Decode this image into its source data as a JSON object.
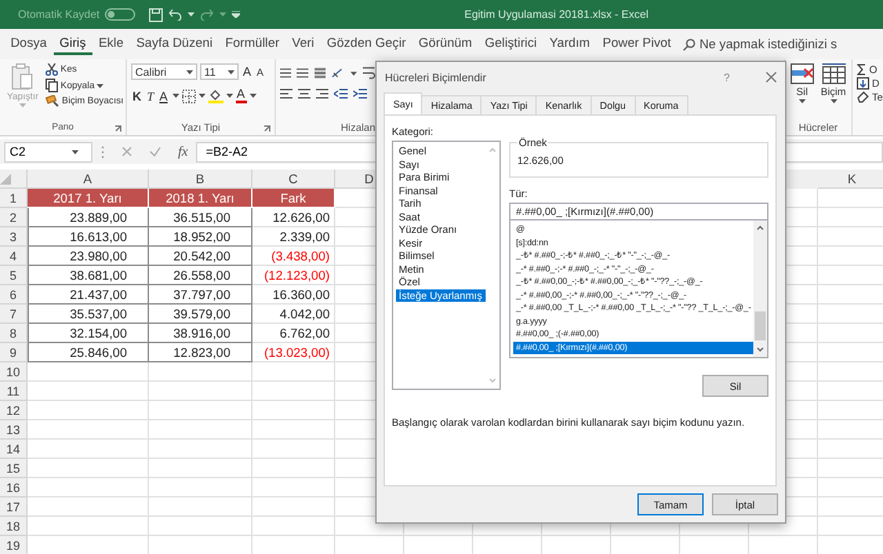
{
  "title_bar": {
    "autosave_label": "Otomatik Kaydet",
    "autosave_on": false,
    "title": "Egitim Uygulamasi 20181.xlsx  -  Excel"
  },
  "menu_tabs": [
    {
      "label": "Dosya",
      "selected": false
    },
    {
      "label": "Giriş",
      "selected": true
    },
    {
      "label": "Ekle",
      "selected": false
    },
    {
      "label": "Sayfa Düzeni",
      "selected": false
    },
    {
      "label": "Formüller",
      "selected": false
    },
    {
      "label": "Veri",
      "selected": false
    },
    {
      "label": "Gözden Geçir",
      "selected": false
    },
    {
      "label": "Görünüm",
      "selected": false
    },
    {
      "label": "Geliştirici",
      "selected": false
    },
    {
      "label": "Yardım",
      "selected": false
    },
    {
      "label": "Power Pivot",
      "selected": false
    }
  ],
  "search": {
    "placeholder": "Ne yapmak istediğinizi s"
  },
  "ribbon": {
    "clipboard": {
      "label": "Pano",
      "paste": "Yapıştır",
      "paste_disabled": true,
      "cut": "Kes",
      "copy": "Kopyala",
      "format_painter": "Biçim Boyacısı"
    },
    "font": {
      "label": "Yazı Tipi",
      "font_name": "Calibri",
      "font_size": "11",
      "grow": "A",
      "shrink": "A",
      "bold": "K",
      "italic": "T",
      "underline": "A",
      "font_color": "A"
    },
    "alignment": {
      "label": "Hizalan"
    },
    "cells": {
      "label": "Hücreler",
      "delete": "Sil",
      "format": "Biçim"
    },
    "editing": {
      "autosum": "O",
      "fill": "D",
      "clear": "Te"
    }
  },
  "formula_bar": {
    "name_box": "C2",
    "fx": "fx",
    "formula": "=B2-A2"
  },
  "sheet": {
    "columns": [
      {
        "label": "A"
      },
      {
        "label": "B"
      },
      {
        "label": "C"
      },
      {
        "label": "D"
      },
      {
        "label": "K"
      }
    ],
    "rows": [
      {
        "number": "1",
        "kind": "header",
        "cells": [
          {
            "text": "2017 1. Yarı",
            "negative": false
          },
          {
            "text": "2018 1. Yarı",
            "negative": false
          },
          {
            "text": "Fark",
            "negative": false
          }
        ]
      },
      {
        "number": "2",
        "kind": "data",
        "cells": [
          {
            "text": "23.889,00",
            "negative": false
          },
          {
            "text": "36.515,00",
            "negative": false
          },
          {
            "text": "12.626,00",
            "negative": false
          }
        ]
      },
      {
        "number": "3",
        "kind": "data",
        "cells": [
          {
            "text": "16.613,00",
            "negative": false
          },
          {
            "text": "18.952,00",
            "negative": false
          },
          {
            "text": "2.339,00",
            "negative": false
          }
        ]
      },
      {
        "number": "4",
        "kind": "data",
        "cells": [
          {
            "text": "23.980,00",
            "negative": false
          },
          {
            "text": "20.542,00",
            "negative": false
          },
          {
            "text": "(3.438,00)",
            "negative": true
          }
        ]
      },
      {
        "number": "5",
        "kind": "data",
        "cells": [
          {
            "text": "38.681,00",
            "negative": false
          },
          {
            "text": "26.558,00",
            "negative": false
          },
          {
            "text": "(12.123,00)",
            "negative": true
          }
        ]
      },
      {
        "number": "6",
        "kind": "data",
        "cells": [
          {
            "text": "21.437,00",
            "negative": false
          },
          {
            "text": "37.797,00",
            "negative": false
          },
          {
            "text": "16.360,00",
            "negative": false
          }
        ]
      },
      {
        "number": "7",
        "kind": "data",
        "cells": [
          {
            "text": "35.537,00",
            "negative": false
          },
          {
            "text": "39.579,00",
            "negative": false
          },
          {
            "text": "4.042,00",
            "negative": false
          }
        ]
      },
      {
        "number": "8",
        "kind": "data",
        "cells": [
          {
            "text": "32.154,00",
            "negative": false
          },
          {
            "text": "38.916,00",
            "negative": false
          },
          {
            "text": "6.762,00",
            "negative": false
          }
        ]
      },
      {
        "number": "9",
        "kind": "data",
        "cells": [
          {
            "text": "25.846,00",
            "negative": false
          },
          {
            "text": "12.823,00",
            "negative": false
          },
          {
            "text": "(13.023,00)",
            "negative": true
          }
        ]
      },
      {
        "number": "10",
        "kind": "empty"
      },
      {
        "number": "11",
        "kind": "empty"
      },
      {
        "number": "12",
        "kind": "empty"
      },
      {
        "number": "13",
        "kind": "empty"
      },
      {
        "number": "14",
        "kind": "empty"
      },
      {
        "number": "15",
        "kind": "empty"
      },
      {
        "number": "16",
        "kind": "empty"
      },
      {
        "number": "17",
        "kind": "empty"
      },
      {
        "number": "18",
        "kind": "empty"
      },
      {
        "number": "19",
        "kind": "empty"
      }
    ]
  },
  "dialog": {
    "title": "Hücreleri Biçimlendir",
    "help": "?",
    "tabs": [
      {
        "label": "Sayı",
        "selected": true
      },
      {
        "label": "Hizalama",
        "selected": false
      },
      {
        "label": "Yazı Tipi",
        "selected": false
      },
      {
        "label": "Kenarlık",
        "selected": false
      },
      {
        "label": "Dolgu",
        "selected": false
      },
      {
        "label": "Koruma",
        "selected": false
      }
    ],
    "category_label": "Kategori:",
    "categories": [
      {
        "label": "Genel",
        "selected": false
      },
      {
        "label": "Sayı",
        "selected": false
      },
      {
        "label": "Para Birimi",
        "selected": false
      },
      {
        "label": "Finansal",
        "selected": false
      },
      {
        "label": "Tarih",
        "selected": false
      },
      {
        "label": "Saat",
        "selected": false
      },
      {
        "label": "Yüzde Oranı",
        "selected": false
      },
      {
        "label": "Kesir",
        "selected": false
      },
      {
        "label": "Bilimsel",
        "selected": false
      },
      {
        "label": "Metin",
        "selected": false
      },
      {
        "label": "Özel",
        "selected": false
      },
      {
        "label": "İsteğe Uyarlanmış",
        "selected": true
      }
    ],
    "sample_label": "Örnek",
    "sample": "12.626,00",
    "type_label": "Tür:",
    "type_value": "#.##0,00_ ;[Kırmızı](#.##0,00)",
    "formats": [
      {
        "label": "@",
        "selected": false
      },
      {
        "label": "[s]:dd:nn",
        "selected": false
      },
      {
        "label": "_-₺* #.##0_-;-₺* #.##0_-;_-₺* \"-\"_-;_-@_-",
        "selected": false
      },
      {
        "label": "_-* #.##0_-;-* #.##0_-;_-* \"-\"_-;_-@_-",
        "selected": false
      },
      {
        "label": "_-₺* #.##0,00_-;-₺* #.##0,00_-;_-₺* \"-\"??_-;_-@_-",
        "selected": false
      },
      {
        "label": "_-* #.##0,00_-;-* #.##0,00_-;_-* \"-\"??_-;_-@_-",
        "selected": false
      },
      {
        "label": "_-* #.##0,00 _T_L_-;-* #.##0,00 _T_L_-;_-* \"-\"?? _T_L_-;_-@_-",
        "selected": false
      },
      {
        "label": "g.a.yyyy",
        "selected": false
      },
      {
        "label": "#.##0,00_ ;(-#.##0,00)",
        "selected": false
      },
      {
        "label": "#.##0,00_ ;[Kırmızı](#.##0,00)",
        "selected": true
      }
    ],
    "delete": "Sil",
    "hint": "Başlangıç olarak varolan kodlardan birini kullanarak sayı biçim kodunu yazın.",
    "ok": "Tamam",
    "cancel": "İptal"
  }
}
